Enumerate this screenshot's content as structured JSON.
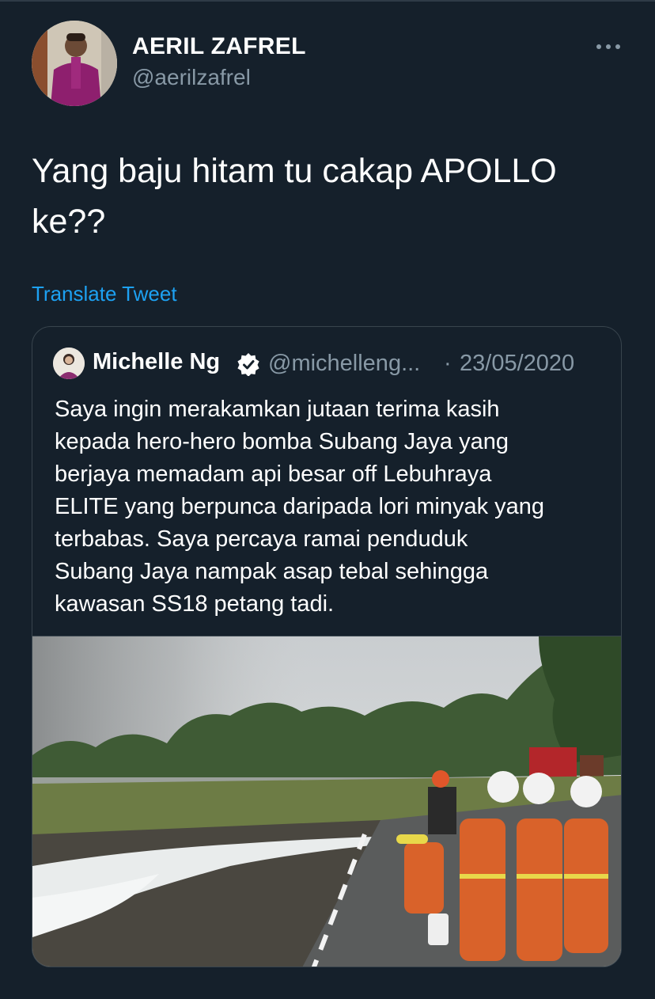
{
  "author": {
    "name": "AERIL ZAFREL",
    "handle": "@aerilzafrel"
  },
  "more_icon": "more-horizontal-icon",
  "tweet": {
    "text_line1": "Yang baju hitam tu cakap APOLLO",
    "text_line2": "ke??",
    "translate_label": "Translate Tweet"
  },
  "quoted_tweet": {
    "name": "Michelle Ng",
    "verified_icon": "verified-badge-icon",
    "handle": "@michelleng...",
    "separator": "·",
    "date": "23/05/2020",
    "lines": [
      "Saya ingin merakamkan jutaan terima kasih",
      "kepada hero-hero bomba Subang Jaya yang",
      "berjaya memadam api besar off Lebuhraya",
      "ELITE yang berpunca daripada lori minyak yang",
      "terbabas. Saya percaya ramai penduduk",
      "Subang Jaya nampak asap tebal sehingga",
      "kawasan SS18 petang tadi."
    ]
  },
  "colors": {
    "background": "#15202b",
    "link": "#1da1f2",
    "secondary_text": "#8899a6",
    "border": "#38444d"
  }
}
